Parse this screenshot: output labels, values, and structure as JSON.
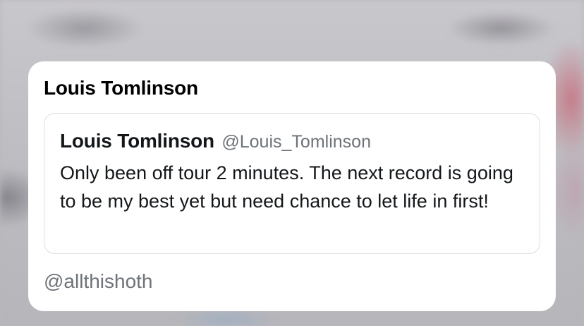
{
  "card": {
    "sender_name": "Louis Tomlinson",
    "quoted_tweet": {
      "author_name": "Louis Tomlinson",
      "author_handle": "@Louis_Tomlinson",
      "text": "Only been off tour 2 minutes. The next record is going to be my best yet but need chance to let life in first!"
    },
    "footer_handle": "@allthishoth"
  }
}
